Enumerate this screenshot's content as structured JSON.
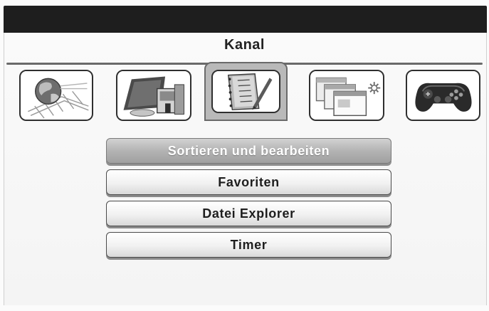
{
  "menu": {
    "title": "Kanal"
  },
  "icon_tabs": [
    {
      "name": "globe-network-icon",
      "selected": false
    },
    {
      "name": "media-player-icon",
      "selected": false
    },
    {
      "name": "channel-list-notepad-icon",
      "selected": true
    },
    {
      "name": "windows-settings-icon",
      "selected": false
    },
    {
      "name": "gamepad-icon",
      "selected": false
    }
  ],
  "submenu": {
    "items": [
      {
        "label": "Sortieren und bearbeiten",
        "selected": true
      },
      {
        "label": "Favoriten",
        "selected": false
      },
      {
        "label": "Datei Explorer",
        "selected": false
      },
      {
        "label": "Timer",
        "selected": false
      }
    ]
  },
  "colors": {
    "header_bar": "#1e1e1e",
    "panel_bg": "#f7f7f7",
    "selected_item": "#b3b3b3",
    "text": "#1e1e1e"
  }
}
